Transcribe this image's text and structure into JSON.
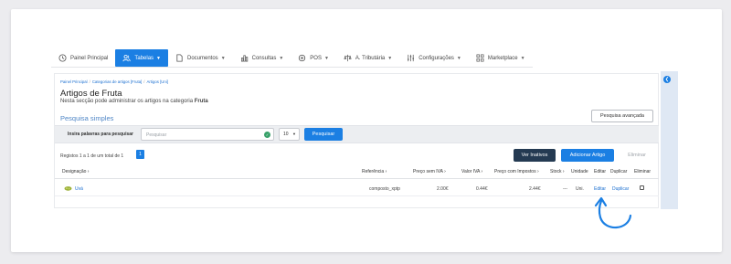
{
  "nav": {
    "items": [
      {
        "label": "Painel Principal",
        "icon": "clock-icon",
        "has_dropdown": false,
        "active": false
      },
      {
        "label": "Tabelas",
        "icon": "users-icon",
        "has_dropdown": true,
        "active": true
      },
      {
        "label": "Documentos",
        "icon": "document-icon",
        "has_dropdown": true,
        "active": false
      },
      {
        "label": "Consultas",
        "icon": "bar-chart-icon",
        "has_dropdown": true,
        "active": false
      },
      {
        "label": "POS",
        "icon": "pos-icon",
        "has_dropdown": true,
        "active": false
      },
      {
        "label": "A. Tributária",
        "icon": "scale-icon",
        "has_dropdown": true,
        "active": false
      },
      {
        "label": "Configurações",
        "icon": "sliders-icon",
        "has_dropdown": true,
        "active": false
      },
      {
        "label": "Marketplace",
        "icon": "grid-icon",
        "has_dropdown": true,
        "active": false
      }
    ]
  },
  "breadcrumb": [
    "Painel Principal",
    "Categorias de artigos [Fruta]",
    "Artigos [Uni]"
  ],
  "page": {
    "title": "Artigos de Fruta",
    "subtitle_prefix": "Nesta secção pode administrar os artigos na categoria",
    "subtitle_category": "Fruta"
  },
  "advanced_search_label": "Pesquisa avançada",
  "search": {
    "title": "Pesquisa simples",
    "label": "Insira palavras para pesquisar",
    "placeholder": "Pesquisar",
    "per_page": "10",
    "button": "Pesquisar"
  },
  "records_text": "Registos 1 a 1 de um total de 1",
  "pagination": {
    "current": "1"
  },
  "actions": {
    "inactive": "Ver Inativos",
    "add": "Adicionar Artigo",
    "delete": "Eliminar"
  },
  "table": {
    "headers": {
      "designation": "Designação",
      "reference": "Referência",
      "price_no_vat": "Preço sem IVA",
      "vat_value": "Valor IVA",
      "price_tax": "Preço com Impostos",
      "stock": "Stock",
      "unit": "Unidade",
      "edit": "Editar",
      "duplicate": "Duplicar",
      "remove": "Eliminar"
    },
    "rows": [
      {
        "designation": "Uvá",
        "reference": "composto_xptp",
        "price_no_vat": "2.00€",
        "vat_value": "0.44€",
        "price_tax": "2.44€",
        "stock": "---",
        "unit": "Uni.",
        "edit": "Editar",
        "duplicate": "Duplicar"
      }
    ]
  },
  "colors": {
    "primary": "#1b7fe3",
    "dark_button": "#243a52",
    "link": "#1b6fd0",
    "arrow": "#1b7fe3"
  }
}
